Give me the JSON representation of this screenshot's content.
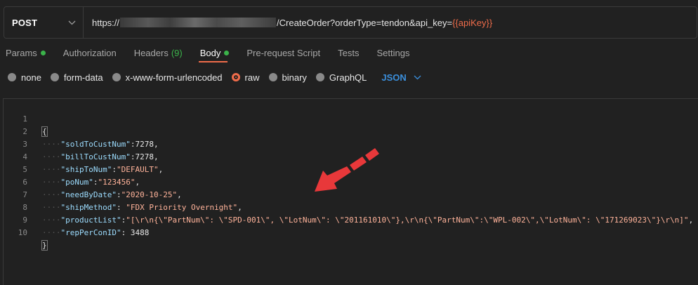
{
  "request": {
    "method": "POST",
    "url_prefix": "https://",
    "url_suffix": "/CreateOrder?orderType=tendon&api_key=",
    "url_variable": "{{apiKey}}"
  },
  "tabs": [
    {
      "label": "Params",
      "dot": true
    },
    {
      "label": "Authorization"
    },
    {
      "label": "Headers",
      "count": "(9)"
    },
    {
      "label": "Body",
      "dot": true,
      "active": true
    },
    {
      "label": "Pre-request Script"
    },
    {
      "label": "Tests"
    },
    {
      "label": "Settings"
    }
  ],
  "body_types": [
    "none",
    "form-data",
    "x-www-form-urlencoded",
    "raw",
    "binary",
    "GraphQL"
  ],
  "body_type_selected": "raw",
  "format_selected": "JSON",
  "editor": {
    "line_numbers": [
      "1",
      "2",
      "3",
      "4",
      "5",
      "6",
      "7",
      "8",
      "9",
      "10"
    ],
    "lines": [
      {
        "open": "{"
      },
      {
        "key": "\"soldToCustNum\"",
        "sep": ":",
        "val": "7278",
        "type": "num",
        "tail": ","
      },
      {
        "key": "\"billToCustNum\"",
        "sep": ":",
        "val": "7278",
        "type": "num",
        "tail": ","
      },
      {
        "key": "\"shipToNum\"",
        "sep": ":",
        "val": "\"DEFAULT\"",
        "type": "str",
        "tail": ","
      },
      {
        "key": "\"poNum\"",
        "sep": ":",
        "val": "\"123456\"",
        "type": "str",
        "tail": ","
      },
      {
        "key": "\"needByDate\"",
        "sep": ":",
        "val": "\"2020-10-25\"",
        "type": "str",
        "tail": ","
      },
      {
        "key": "\"shipMethod\"",
        "sep": ": ",
        "val": "\"FDX Priority Overnight\"",
        "type": "str",
        "tail": ","
      },
      {
        "key": "\"productList\"",
        "sep": ":",
        "val": "\"[\\r\\n{\\\"PartNum\\\": \\\"SPD-001\\\", \\\"LotNum\\\": \\\"201161010\\\"},\\r\\n{\\\"PartNum\\\":\\\"WPL-002\\\",\\\"LotNum\\\": \\\"171269023\\\"}\\r\\n]\"",
        "type": "str",
        "tail": ","
      },
      {
        "key": "\"repPerConID\"",
        "sep": ": ",
        "val": "3488",
        "type": "num",
        "tail": ""
      },
      {
        "close": "}"
      }
    ]
  },
  "colors": {
    "background": "#212121",
    "accent": "#ef6c4a",
    "status_dot": "#3bb34a",
    "json_select": "#3b8fdc",
    "arrow": "#e8383a"
  },
  "icons": {
    "method_dropdown": "chevron-down-icon",
    "format_dropdown": "chevron-down-icon",
    "annotation": "red-arrow-icon"
  }
}
